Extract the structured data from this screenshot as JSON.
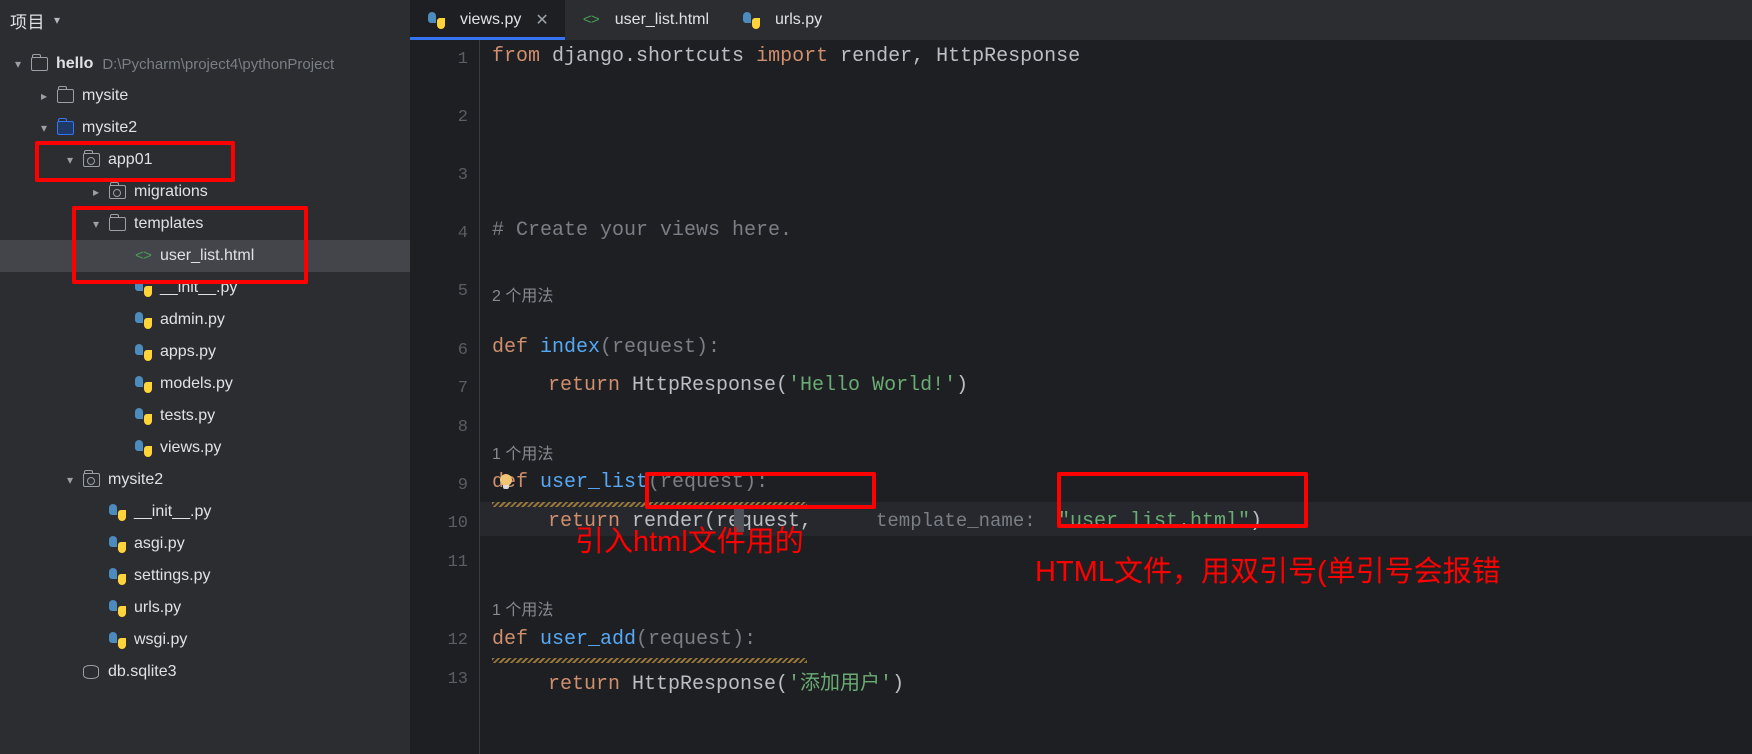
{
  "sidebar": {
    "title": "项目",
    "chevron_icon": "chevron-down-icon",
    "tree": [
      {
        "id": "hello",
        "label": "hello",
        "path": "D:\\Pycharm\\project4\\pythonProject",
        "indent": 0,
        "twisty": "down",
        "icon": "folder",
        "bold": true,
        "selected": false
      },
      {
        "id": "mysite",
        "label": "mysite",
        "path": "",
        "indent": 1,
        "twisty": "right",
        "icon": "folder",
        "bold": false,
        "selected": false
      },
      {
        "id": "mysite2",
        "label": "mysite2",
        "path": "",
        "indent": 1,
        "twisty": "down",
        "icon": "folder-blue",
        "bold": false,
        "selected": false
      },
      {
        "id": "app01",
        "label": "app01",
        "path": "",
        "indent": 2,
        "twisty": "down",
        "icon": "folder-module",
        "bold": false,
        "selected": false
      },
      {
        "id": "migrations",
        "label": "migrations",
        "path": "",
        "indent": 3,
        "twisty": "right",
        "icon": "folder-module",
        "bold": false,
        "selected": false
      },
      {
        "id": "templates",
        "label": "templates",
        "path": "",
        "indent": 3,
        "twisty": "down",
        "icon": "folder",
        "bold": false,
        "selected": false
      },
      {
        "id": "user_list",
        "label": "user_list.html",
        "path": "",
        "indent": 4,
        "twisty": "none",
        "icon": "html",
        "bold": false,
        "selected": true
      },
      {
        "id": "app01_init",
        "label": "__init__.py",
        "path": "",
        "indent": 4,
        "twisty": "none",
        "icon": "python",
        "bold": false,
        "selected": false
      },
      {
        "id": "admin",
        "label": "admin.py",
        "path": "",
        "indent": 4,
        "twisty": "none",
        "icon": "python",
        "bold": false,
        "selected": false
      },
      {
        "id": "apps",
        "label": "apps.py",
        "path": "",
        "indent": 4,
        "twisty": "none",
        "icon": "python",
        "bold": false,
        "selected": false
      },
      {
        "id": "models",
        "label": "models.py",
        "path": "",
        "indent": 4,
        "twisty": "none",
        "icon": "python",
        "bold": false,
        "selected": false
      },
      {
        "id": "tests",
        "label": "tests.py",
        "path": "",
        "indent": 4,
        "twisty": "none",
        "icon": "python",
        "bold": false,
        "selected": false
      },
      {
        "id": "views",
        "label": "views.py",
        "path": "",
        "indent": 4,
        "twisty": "none",
        "icon": "python",
        "bold": false,
        "selected": false
      },
      {
        "id": "mysite2_pkg",
        "label": "mysite2",
        "path": "",
        "indent": 2,
        "twisty": "down",
        "icon": "folder-module",
        "bold": false,
        "selected": false
      },
      {
        "id": "m2_init",
        "label": "__init__.py",
        "path": "",
        "indent": 3,
        "twisty": "none",
        "icon": "python",
        "bold": false,
        "selected": false
      },
      {
        "id": "asgi",
        "label": "asgi.py",
        "path": "",
        "indent": 3,
        "twisty": "none",
        "icon": "python",
        "bold": false,
        "selected": false
      },
      {
        "id": "settings",
        "label": "settings.py",
        "path": "",
        "indent": 3,
        "twisty": "none",
        "icon": "python",
        "bold": false,
        "selected": false
      },
      {
        "id": "urls",
        "label": "urls.py",
        "path": "",
        "indent": 3,
        "twisty": "none",
        "icon": "python",
        "bold": false,
        "selected": false
      },
      {
        "id": "wsgi",
        "label": "wsgi.py",
        "path": "",
        "indent": 3,
        "twisty": "none",
        "icon": "python",
        "bold": false,
        "selected": false
      },
      {
        "id": "dbsqlite",
        "label": "db.sqlite3",
        "path": "",
        "indent": 2,
        "twisty": "none",
        "icon": "db",
        "bold": false,
        "selected": false
      }
    ]
  },
  "tabs": [
    {
      "id": "views",
      "label": "views.py",
      "icon": "python",
      "active": true,
      "closable": true
    },
    {
      "id": "user_list",
      "label": "user_list.html",
      "icon": "html",
      "active": false,
      "closable": false
    },
    {
      "id": "urls",
      "label": "urls.py",
      "icon": "python",
      "active": false,
      "closable": false
    }
  ],
  "editor": {
    "line_numbers": [
      "1",
      "2",
      "3",
      "4",
      "5",
      "6",
      "7",
      "8",
      "9",
      "10",
      "11",
      "12",
      "13"
    ],
    "current_line": "10",
    "code_lens": [
      {
        "text": "2 个用法",
        "above_line": "6"
      },
      {
        "text": "1 个用法",
        "above_line": "9"
      },
      {
        "text": "1 个用法",
        "above_line": "12"
      }
    ],
    "inlay_hints": [
      {
        "text": "template_name:",
        "line": "10"
      }
    ],
    "code_lines": {
      "l1_from": "from",
      "l1_module": " django.shortcuts ",
      "l1_import": "import",
      "l1_names": " render, HttpResponse",
      "l4_comment": "# Create your views here.",
      "l6_def": "def",
      "l6_name": " index",
      "l6_args": "(request):",
      "l7_return": "return",
      "l7_call": " HttpResponse(",
      "l7_str": "'Hello World!'",
      "l7_close": ")",
      "l9_def": "def",
      "l9_name": " user_list",
      "l9_args": "(request):",
      "l10_return": "return",
      "l10_call": " render(request, ",
      "l10_str": "\"user_list.html\"",
      "l10_close": ")",
      "l12_def": "def",
      "l12_name": " user_add",
      "l12_args": "(request):",
      "l13_return": "return",
      "l13_call": " HttpResponse(",
      "l13_str": "'添加用户'",
      "l13_close": ")"
    }
  },
  "annotations": {
    "color": "#ff0000",
    "text_render": "引入html文件用的",
    "text_html": "HTML文件，用双引号(单引号会报错"
  }
}
